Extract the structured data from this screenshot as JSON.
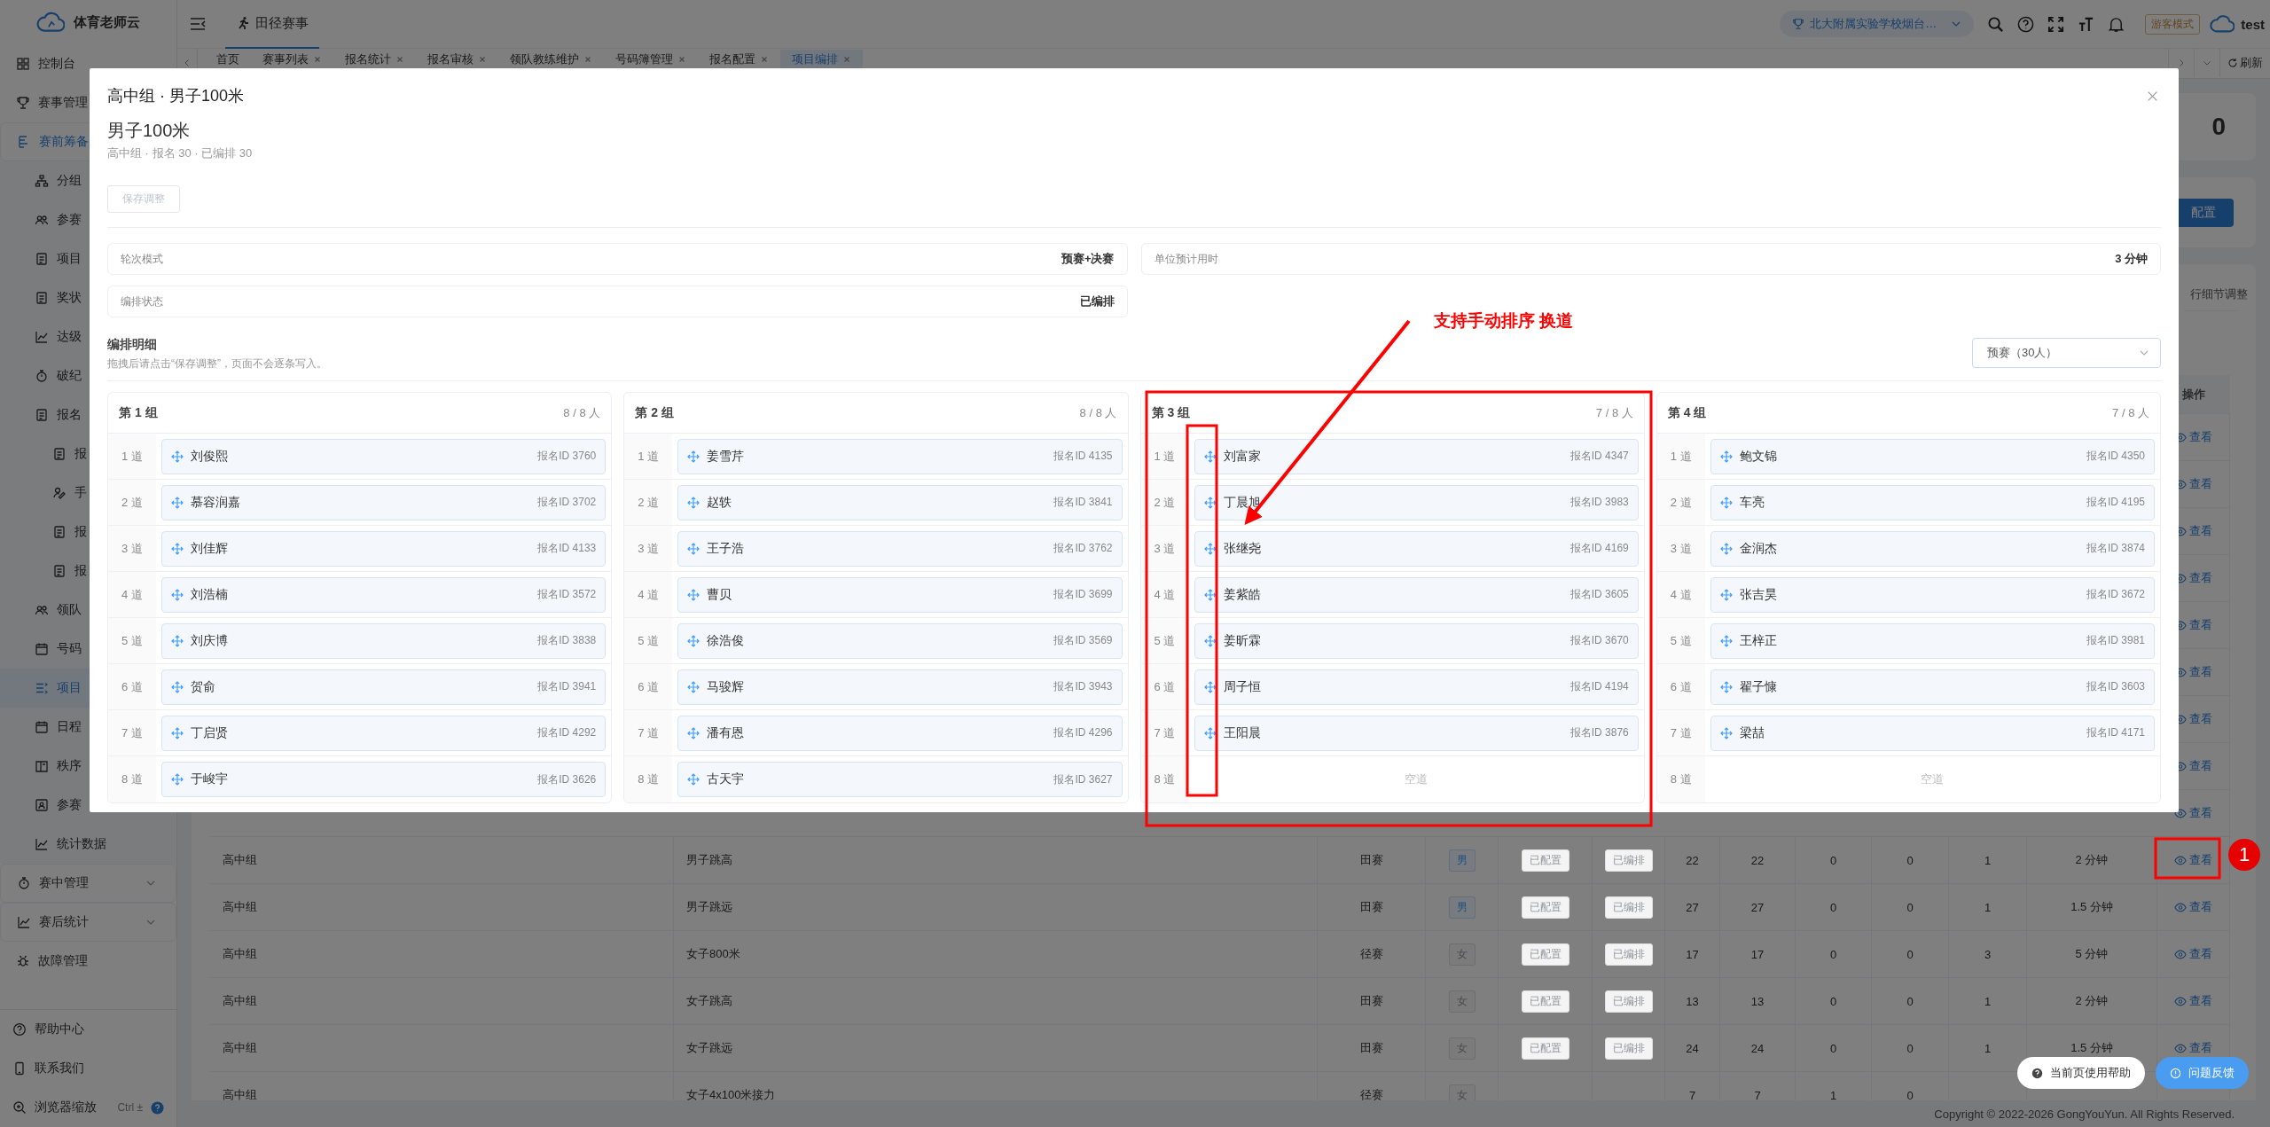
{
  "sidebar": {
    "brand": "体育老师云",
    "items": [
      {
        "label": "控制台",
        "kind": "top",
        "selected": false
      },
      {
        "label": "赛事管理",
        "kind": "top",
        "selected": false
      },
      {
        "label": "赛前筹备",
        "kind": "group",
        "expanded": true,
        "selected": false
      },
      {
        "label": "分组",
        "kind": "sub",
        "selected": false
      },
      {
        "label": "参赛",
        "kind": "sub",
        "selected": false
      },
      {
        "label": "项目",
        "kind": "sub",
        "selected": false
      },
      {
        "label": "奖状",
        "kind": "sub",
        "selected": false
      },
      {
        "label": "达级",
        "kind": "sub",
        "selected": false
      },
      {
        "label": "破纪",
        "kind": "sub",
        "selected": false
      },
      {
        "label": "报名",
        "kind": "sub",
        "selected": false
      },
      {
        "label": "报",
        "kind": "subsub",
        "selected": false
      },
      {
        "label": "手",
        "kind": "subsub",
        "selected": false
      },
      {
        "label": "报",
        "kind": "subsub",
        "selected": false
      },
      {
        "label": "报",
        "kind": "subsub",
        "selected": false
      },
      {
        "label": "领队",
        "kind": "sub",
        "selected": false
      },
      {
        "label": "号码",
        "kind": "sub",
        "selected": false
      },
      {
        "label": "项目",
        "kind": "sub",
        "selected": true
      },
      {
        "label": "日程",
        "kind": "sub",
        "selected": false
      },
      {
        "label": "秩序",
        "kind": "sub",
        "selected": false
      },
      {
        "label": "参赛",
        "kind": "sub",
        "selected": false
      },
      {
        "label": "统计数据",
        "kind": "sub",
        "selected": false
      },
      {
        "label": "赛中管理",
        "kind": "group",
        "expanded": false,
        "selected": false
      },
      {
        "label": "赛后统计",
        "kind": "group",
        "expanded": false,
        "selected": false
      },
      {
        "label": "故障管理",
        "kind": "top",
        "selected": false
      }
    ],
    "footer": [
      {
        "label": "帮助中心"
      },
      {
        "label": "联系我们"
      },
      {
        "label": "浏览器缩放",
        "shortcut": "Ctrl ±"
      }
    ]
  },
  "header": {
    "title_tab": "田径赛事",
    "school": "北大附属实验学校烟台…",
    "badge": "游客模式",
    "user": "test"
  },
  "tab_bar": {
    "tabs": [
      {
        "label": "首页",
        "closable": false,
        "selected": false
      },
      {
        "label": "赛事列表",
        "closable": true,
        "selected": false
      },
      {
        "label": "报名统计",
        "closable": true,
        "selected": false
      },
      {
        "label": "报名审核",
        "closable": true,
        "selected": false
      },
      {
        "label": "领队教练维护",
        "closable": true,
        "selected": false
      },
      {
        "label": "号码簿管理",
        "closable": true,
        "selected": false
      },
      {
        "label": "报名配置",
        "closable": true,
        "selected": false
      },
      {
        "label": "项目编排",
        "closable": true,
        "selected": true
      }
    ],
    "refresh": "刷新"
  },
  "background": {
    "stat_value": "0",
    "config_button": "配置",
    "note": "行细节调整",
    "table": {
      "action_header": "操作",
      "rows": [
        {
          "action": "查看"
        },
        {
          "action": "查看"
        },
        {
          "action": "查看"
        },
        {
          "action": "查看"
        },
        {
          "action": "查看"
        },
        {
          "action": "查看"
        },
        {
          "action": "查看"
        },
        {
          "action": "查看"
        },
        {
          "action": "查看"
        },
        {
          "group": "高中组",
          "event": "男子跳高",
          "type": "田赛",
          "gender": {
            "text": "男",
            "color": "#204f80"
          },
          "config": "已配置",
          "arrange": "已编排",
          "values": [
            "22",
            "22",
            "0",
            "0",
            "1"
          ],
          "duration": "2 分钟",
          "action": "查看"
        },
        {
          "group": "高中组",
          "event": "男子跳远",
          "type": "田赛",
          "gender": {
            "text": "男",
            "color": "#204f80"
          },
          "config": "已配置",
          "arrange": "已编排",
          "values": [
            "27",
            "27",
            "0",
            "0",
            "1"
          ],
          "duration": "1.5 分钟",
          "action": "查看"
        },
        {
          "group": "高中组",
          "event": "女子800米",
          "type": "径赛",
          "gender": {
            "text": "女",
            "color": "#484a4d"
          },
          "config": "已配置",
          "arrange": "已编排",
          "values": [
            "17",
            "17",
            "0",
            "0",
            "3"
          ],
          "duration": "5 分钟",
          "action": "查看"
        },
        {
          "group": "高中组",
          "event": "女子跳高",
          "type": "田赛",
          "gender": {
            "text": "女",
            "color": "#484a4d"
          },
          "config": "已配置",
          "arrange": "已编排",
          "values": [
            "13",
            "13",
            "0",
            "0",
            "1"
          ],
          "duration": "2 分钟",
          "action": "查看"
        },
        {
          "group": "高中组",
          "event": "女子跳远",
          "type": "田赛",
          "gender": {
            "text": "女",
            "color": "#484a4d"
          },
          "config": "已配置",
          "arrange": "已编排",
          "values": [
            "24",
            "24",
            "0",
            "0",
            "1"
          ],
          "duration": "1.5 分钟",
          "action": "查看"
        },
        {
          "group": "高中组",
          "event": "女子4x100米接力",
          "type": "径赛",
          "gender": {
            "text": "女",
            "color": "#484a4d"
          },
          "values": [
            "7",
            "7",
            "1",
            "0"
          ]
        }
      ]
    }
  },
  "footer": "Copyright © 2022-2026 GongYouYun. All Rights Reserved.",
  "modal": {
    "title": "高中组 · 男子100米",
    "event": "男子100米",
    "summary": "高中组 · 报名 30 · 已编排 30",
    "save_button": {
      "label": "保存调整",
      "disabled": true
    },
    "info": [
      {
        "label": "轮次模式",
        "value": "预赛+决赛"
      },
      {
        "label": "单位预计用时",
        "value": "3 分钟"
      },
      {
        "label": "编排状态",
        "value": "已编排"
      }
    ],
    "section_title": "编排明细",
    "hint": "拖拽后请点击“保存调整”，页面不会逐条写入。",
    "round_select": "预赛（30人）",
    "groups": [
      {
        "title": "第 1 组",
        "count": "8 / 8 人",
        "lanes": [
          {
            "lane": "1 道",
            "kind": "athlete",
            "name": "刘俊熙",
            "entry_id": "报名ID 3760"
          },
          {
            "lane": "2 道",
            "kind": "athlete",
            "name": "慕容润嘉",
            "entry_id": "报名ID 3702"
          },
          {
            "lane": "3 道",
            "kind": "athlete",
            "name": "刘佳辉",
            "entry_id": "报名ID 4133"
          },
          {
            "lane": "4 道",
            "kind": "athlete",
            "name": "刘浩楠",
            "entry_id": "报名ID 3572"
          },
          {
            "lane": "5 道",
            "kind": "athlete",
            "name": "刘庆博",
            "entry_id": "报名ID 3838"
          },
          {
            "lane": "6 道",
            "kind": "athlete",
            "name": "贺俞",
            "entry_id": "报名ID 3941"
          },
          {
            "lane": "7 道",
            "kind": "athlete",
            "name": "丁启贤",
            "entry_id": "报名ID 4292"
          },
          {
            "lane": "8 道",
            "kind": "athlete",
            "name": "于峻宇",
            "entry_id": "报名ID 3626"
          }
        ]
      },
      {
        "title": "第 2 组",
        "count": "8 / 8 人",
        "lanes": [
          {
            "lane": "1 道",
            "kind": "athlete",
            "name": "姜雪芹",
            "entry_id": "报名ID 4135"
          },
          {
            "lane": "2 道",
            "kind": "athlete",
            "name": "赵轶",
            "entry_id": "报名ID 3841"
          },
          {
            "lane": "3 道",
            "kind": "athlete",
            "name": "王子浩",
            "entry_id": "报名ID 3762"
          },
          {
            "lane": "4 道",
            "kind": "athlete",
            "name": "曹贝",
            "entry_id": "报名ID 3699"
          },
          {
            "lane": "5 道",
            "kind": "athlete",
            "name": "徐浩俊",
            "entry_id": "报名ID 3569"
          },
          {
            "lane": "6 道",
            "kind": "athlete",
            "name": "马骏辉",
            "entry_id": "报名ID 3943"
          },
          {
            "lane": "7 道",
            "kind": "athlete",
            "name": "潘有恩",
            "entry_id": "报名ID 4296"
          },
          {
            "lane": "8 道",
            "kind": "athlete",
            "name": "古天宇",
            "entry_id": "报名ID 3627"
          }
        ]
      },
      {
        "title": "第 3 组",
        "count": "7 / 8 人",
        "lanes": [
          {
            "lane": "1 道",
            "kind": "athlete",
            "name": "刘富家",
            "entry_id": "报名ID 4347"
          },
          {
            "lane": "2 道",
            "kind": "athlete",
            "name": "丁晨旭",
            "entry_id": "报名ID 3983"
          },
          {
            "lane": "3 道",
            "kind": "athlete",
            "name": "张继尧",
            "entry_id": "报名ID 4169"
          },
          {
            "lane": "4 道",
            "kind": "athlete",
            "name": "姜紫皓",
            "entry_id": "报名ID 3605"
          },
          {
            "lane": "5 道",
            "kind": "athlete",
            "name": "姜昕霖",
            "entry_id": "报名ID 3670"
          },
          {
            "lane": "6 道",
            "kind": "athlete",
            "name": "周子恒",
            "entry_id": "报名ID 4194"
          },
          {
            "lane": "7 道",
            "kind": "athlete",
            "name": "王阳晨",
            "entry_id": "报名ID 3876"
          },
          {
            "lane": "8 道",
            "kind": "empty",
            "empty_label": "空道"
          }
        ]
      },
      {
        "title": "第 4 组",
        "count": "7 / 8 人",
        "lanes": [
          {
            "lane": "1 道",
            "kind": "athlete",
            "name": "鲍文锦",
            "entry_id": "报名ID 4350"
          },
          {
            "lane": "2 道",
            "kind": "athlete",
            "name": "车亮",
            "entry_id": "报名ID 4195"
          },
          {
            "lane": "3 道",
            "kind": "athlete",
            "name": "金润杰",
            "entry_id": "报名ID 3874"
          },
          {
            "lane": "4 道",
            "kind": "athlete",
            "name": "张吉昊",
            "entry_id": "报名ID 3672"
          },
          {
            "lane": "5 道",
            "kind": "athlete",
            "name": "王梓正",
            "entry_id": "报名ID 3981"
          },
          {
            "lane": "6 道",
            "kind": "athlete",
            "name": "翟子慷",
            "entry_id": "报名ID 3603"
          },
          {
            "lane": "7 道",
            "kind": "athlete",
            "name": "梁喆",
            "entry_id": "报名ID 4171"
          },
          {
            "lane": "8 道",
            "kind": "empty",
            "empty_label": "空道"
          }
        ]
      }
    ]
  },
  "floating_buttons": [
    {
      "label": "当前页使用帮助",
      "kind": "help"
    },
    {
      "label": "问题反馈",
      "kind": "feedback"
    }
  ],
  "annotations": {
    "callout": "支持手动排序 换道",
    "step": "1"
  }
}
